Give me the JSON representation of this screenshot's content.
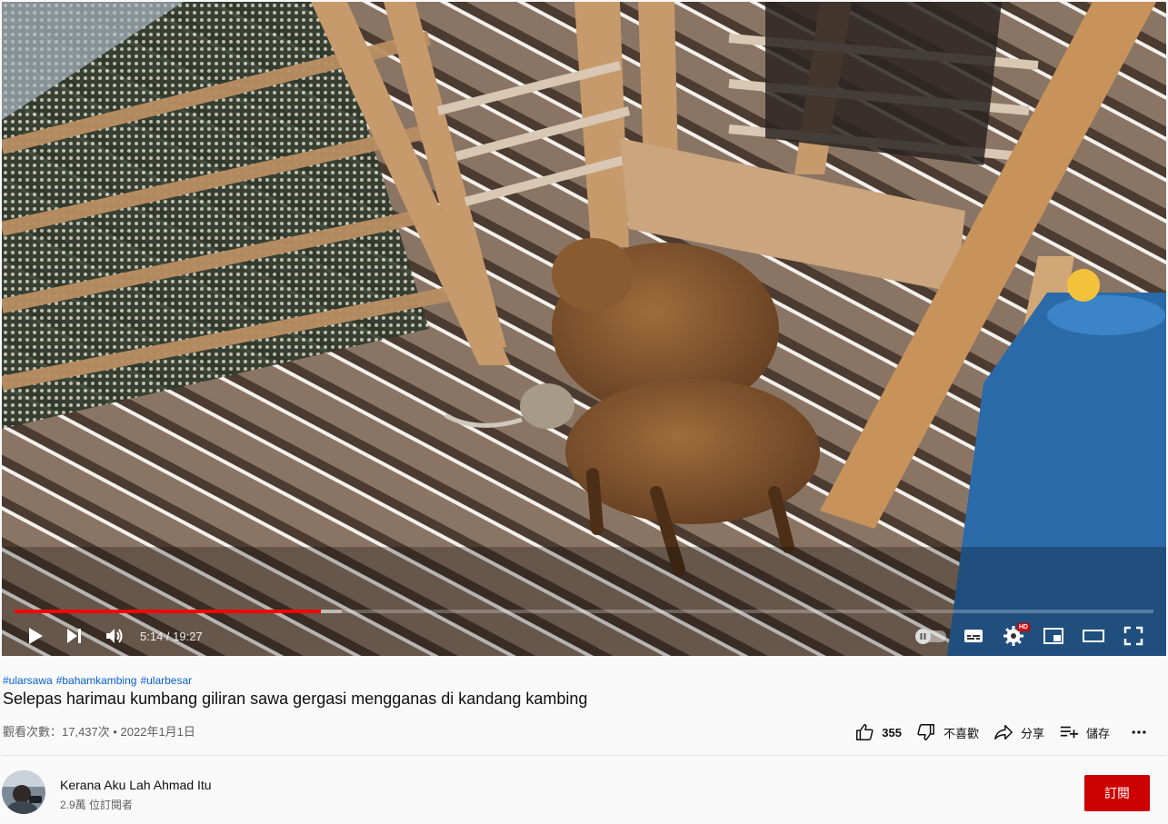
{
  "player": {
    "time_current": "5:14",
    "time_separator": " / ",
    "time_total": "19:27",
    "progress_fraction": 0.2691,
    "buffer_fraction": 0.287,
    "hd_badge": "HD"
  },
  "video": {
    "hashtags": [
      "#ularsawa",
      "#bahamkambing",
      "#ularbesar"
    ],
    "title": "Selepas harimau kumbang giliran sawa gergasi mengganas di kandang kambing",
    "views_date": "觀看次數：17,437次 • 2022年1月1日"
  },
  "actions": {
    "like_count": "355",
    "dislike_label": "不喜歡",
    "share_label": "分享",
    "save_label": "儲存"
  },
  "channel": {
    "name": "Kerana Aku Lah Ahmad Itu",
    "subscribers": "2.9萬 位訂閱者",
    "subscribe_label": "訂閱"
  },
  "colors": {
    "accent_red": "#cc0000",
    "progress_red": "#ff0000",
    "link_blue": "#065fd4"
  }
}
